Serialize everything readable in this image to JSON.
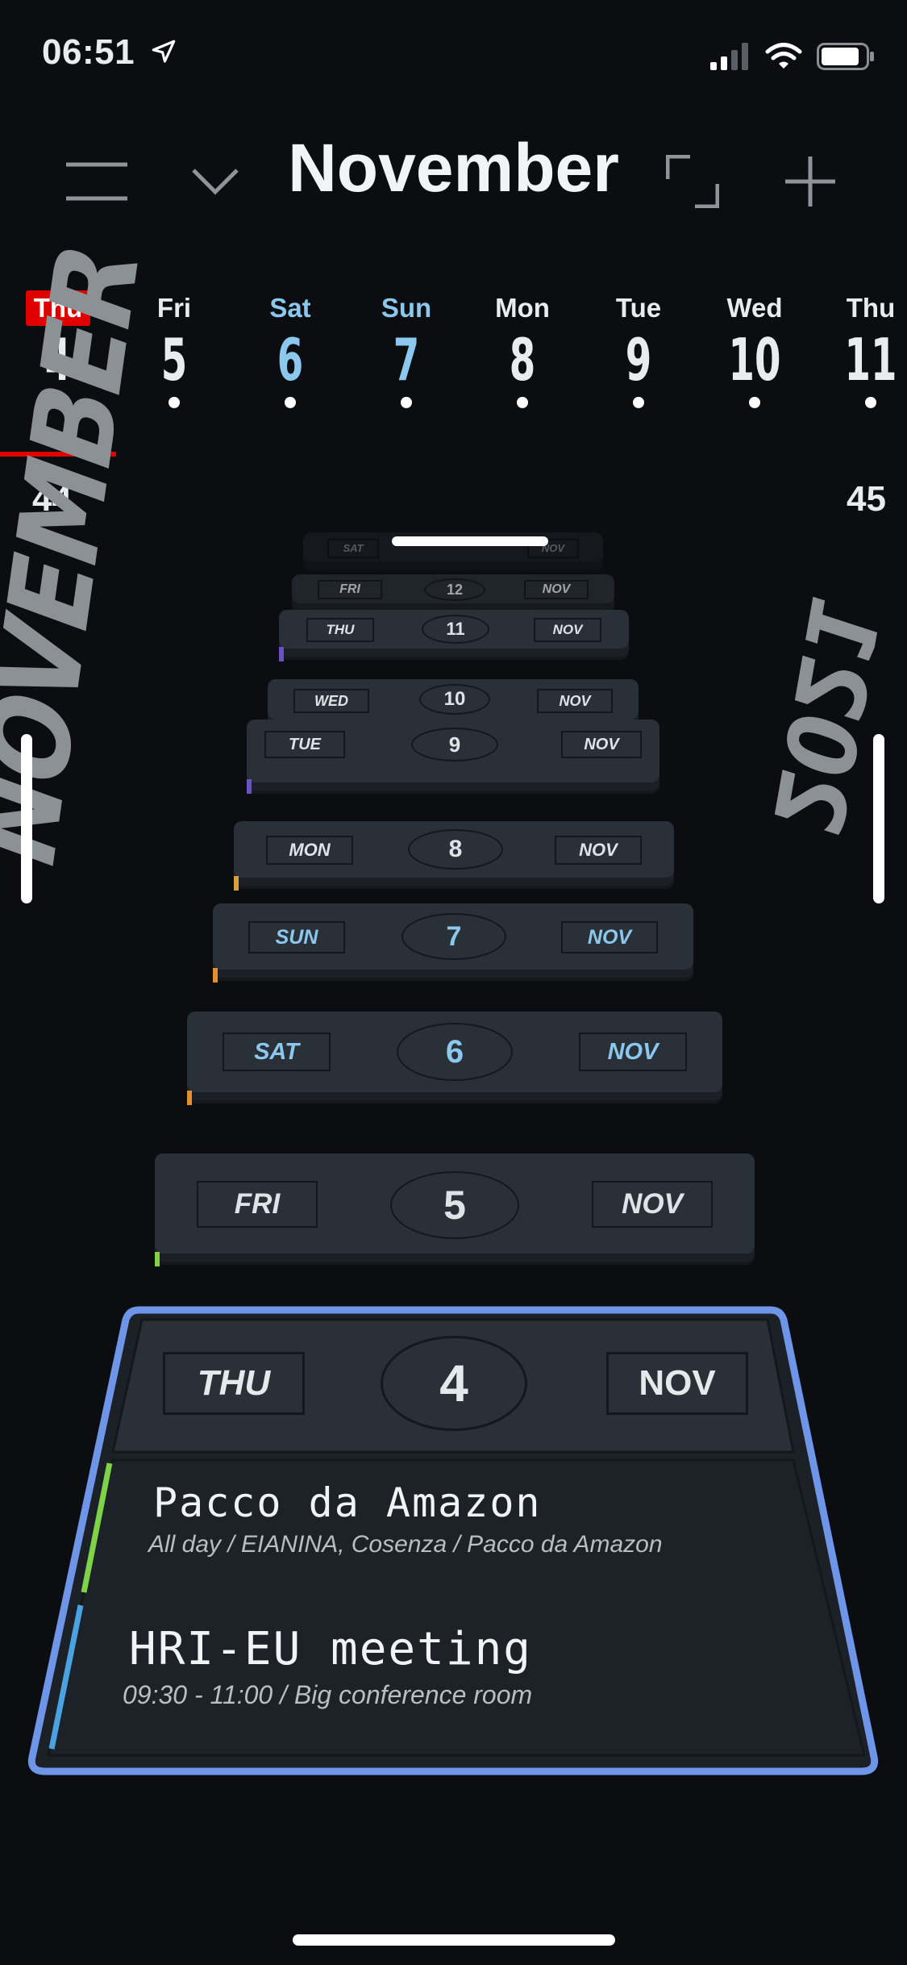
{
  "status_bar": {
    "time": "06:51"
  },
  "header": {
    "title": "November"
  },
  "week_strip": {
    "days": [
      {
        "name": "Thu",
        "number": "4",
        "today": true,
        "weekend": false
      },
      {
        "name": "Fri",
        "number": "5",
        "today": false,
        "weekend": false
      },
      {
        "name": "Sat",
        "number": "6",
        "today": false,
        "weekend": true
      },
      {
        "name": "Sun",
        "number": "7",
        "today": false,
        "weekend": true
      },
      {
        "name": "Mon",
        "number": "8",
        "today": false,
        "weekend": false
      },
      {
        "name": "Tue",
        "number": "9",
        "today": false,
        "weekend": false
      },
      {
        "name": "Wed",
        "number": "10",
        "today": false,
        "weekend": false
      },
      {
        "name": "Thu",
        "number": "11",
        "today": false,
        "weekend": false
      }
    ],
    "week_numbers": [
      "44",
      "45"
    ]
  },
  "side": {
    "month": "NOVEMBER",
    "year": "2021"
  },
  "stack": {
    "cards": [
      {
        "day": "SAT",
        "num": "13",
        "month": "NOV"
      },
      {
        "day": "FRI",
        "num": "12",
        "month": "NOV"
      },
      {
        "day": "THU",
        "num": "11",
        "month": "NOV"
      },
      {
        "day": "WED",
        "num": "10",
        "month": "NOV"
      },
      {
        "day": "TUE",
        "num": "9",
        "month": "NOV"
      },
      {
        "day": "MON",
        "num": "8",
        "month": "NOV"
      },
      {
        "day": "SUN",
        "num": "7",
        "month": "NOV"
      },
      {
        "day": "SAT",
        "num": "6",
        "month": "NOV"
      },
      {
        "day": "FRI",
        "num": "5",
        "month": "NOV"
      }
    ]
  },
  "selected": {
    "day": "THU",
    "num": "4",
    "month": "NOV",
    "events": [
      {
        "title": "Pacco da Amazon",
        "details": "All day / EIANINA, Cosenza / Pacco da Amazon",
        "color": "#7ed348"
      },
      {
        "title": "HRI-EU meeting",
        "details": "09:30 - 11:00 / Big conference room",
        "color": "#4aa3e0"
      }
    ]
  },
  "colors": {
    "accent": "#6f95e8",
    "today": "#e00000",
    "weekend": "#8cc8ee"
  }
}
